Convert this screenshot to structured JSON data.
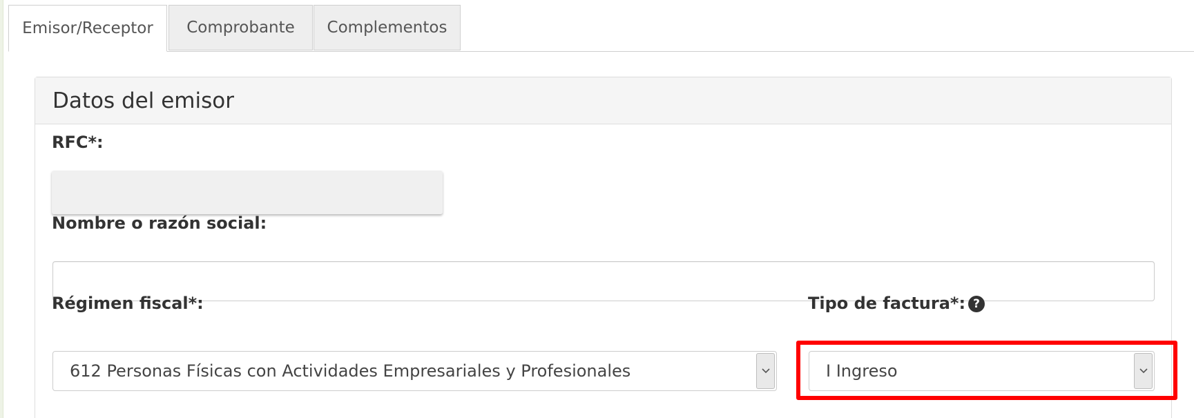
{
  "tabs": [
    {
      "label": "Emisor/Receptor",
      "active": true
    },
    {
      "label": "Comprobante",
      "active": false
    },
    {
      "label": "Complementos",
      "active": false
    }
  ],
  "panel": {
    "title": "Datos del emisor"
  },
  "form": {
    "rfc_label": "RFC*:",
    "rfc_value": "",
    "nombre_label": "Nombre o razón social:",
    "nombre_value": "",
    "regimen_label": "Régimen fiscal*:",
    "regimen_value": "612 Personas Físicas con Actividades Empresariales y Profesionales",
    "tipo_label": "Tipo de factura*:",
    "tipo_value": "I Ingreso"
  },
  "icons": {
    "help": "question-circle-icon",
    "dropdown": "chevron-down-icon"
  },
  "colors": {
    "highlight": "#ff0000",
    "tab_inactive_bg": "#eeeeee",
    "panel_heading_bg": "#f5f5f5"
  }
}
